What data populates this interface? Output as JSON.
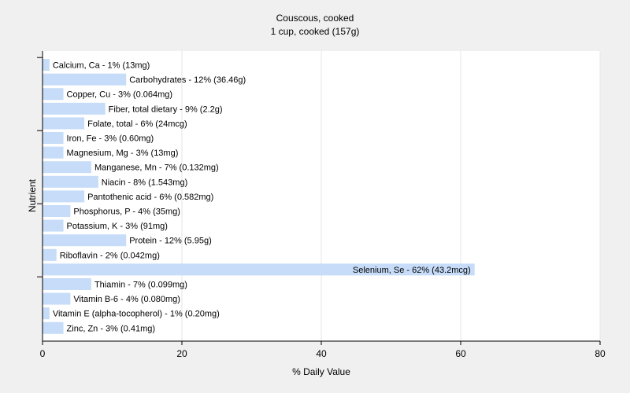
{
  "chart_data": {
    "type": "bar",
    "orientation": "horizontal",
    "title": "Couscous, cooked",
    "subtitle": "1 cup, cooked (157g)",
    "xlabel": "% Daily Value",
    "ylabel": "Nutrient",
    "xlim": [
      0,
      80
    ],
    "xticks": [
      0,
      20,
      40,
      60,
      80
    ],
    "grid": true,
    "bar_color": "#c6dcf8",
    "background_color": "#f0f0f0",
    "plot_background_color": "#ffffff",
    "categories": [
      "Calcium, Ca",
      "Carbohydrates",
      "Copper, Cu",
      "Fiber, total dietary",
      "Folate, total",
      "Iron, Fe",
      "Magnesium, Mg",
      "Manganese, Mn",
      "Niacin",
      "Pantothenic acid",
      "Phosphorus, P",
      "Potassium, K",
      "Protein",
      "Riboflavin",
      "Selenium, Se",
      "Thiamin",
      "Vitamin B-6",
      "Vitamin E (alpha-tocopherol)",
      "Zinc, Zn"
    ],
    "values": [
      1,
      12,
      3,
      9,
      6,
      3,
      3,
      7,
      8,
      6,
      4,
      3,
      12,
      2,
      62,
      7,
      4,
      1,
      3
    ],
    "labels": [
      "Calcium, Ca - 1% (13mg)",
      "Carbohydrates - 12% (36.46g)",
      "Copper, Cu - 3% (0.064mg)",
      "Fiber, total dietary - 9% (2.2g)",
      "Folate, total - 6% (24mcg)",
      "Iron, Fe - 3% (0.60mg)",
      "Magnesium, Mg - 3% (13mg)",
      "Manganese, Mn - 7% (0.132mg)",
      "Niacin - 8% (1.543mg)",
      "Pantothenic acid - 6% (0.582mg)",
      "Phosphorus, P - 4% (35mg)",
      "Potassium, K - 3% (91mg)",
      "Protein - 12% (5.95g)",
      "Riboflavin - 2% (0.042mg)",
      "Selenium, Se - 62% (43.2mcg)",
      "Thiamin - 7% (0.099mg)",
      "Vitamin B-6 - 4% (0.080mg)",
      "Vitamin E (alpha-tocopherol) - 1% (0.20mg)",
      "Zinc, Zn - 3% (0.41mg)"
    ]
  }
}
